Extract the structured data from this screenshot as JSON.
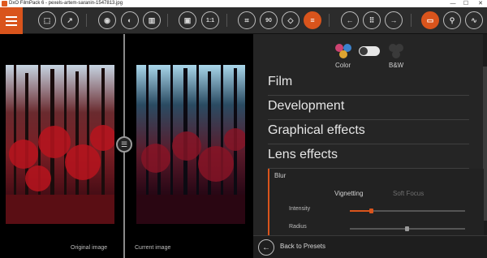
{
  "window": {
    "title": "DxO FilmPack 6 - pexels-artem-saranin-1547813.jpg",
    "minimize": "—",
    "maximize": "☐",
    "close": "✕"
  },
  "toolbar": {
    "hamburger_icon": "menu-icon",
    "buttons": [
      {
        "name": "import-photo-button",
        "glyph": "⬚"
      },
      {
        "name": "export-photo-button",
        "glyph": "↗"
      },
      {
        "name": "preview-eye-button",
        "glyph": "◉"
      },
      {
        "name": "compare-presets-button",
        "glyph": "◐"
      },
      {
        "name": "split-view-button",
        "glyph": "▥"
      },
      {
        "name": "fit-to-screen-button",
        "glyph": "▣"
      },
      {
        "name": "zoom-100-button",
        "glyph": "1:1"
      },
      {
        "name": "crop-button",
        "glyph": "⌗"
      },
      {
        "name": "rotate-90-button",
        "glyph": "90"
      },
      {
        "name": "straighten-button",
        "glyph": "◇"
      },
      {
        "name": "adjustments-button",
        "glyph": "≡"
      },
      {
        "name": "previous-image-button",
        "glyph": "←"
      },
      {
        "name": "grid-view-button",
        "glyph": "⠿"
      },
      {
        "name": "next-image-button",
        "glyph": "→"
      },
      {
        "name": "monitor-view-button",
        "glyph": "▭"
      },
      {
        "name": "loupe-button",
        "glyph": "⚲"
      },
      {
        "name": "histogram-button",
        "glyph": "∿"
      }
    ]
  },
  "viewer": {
    "original_label": "Original image",
    "current_label": "Current image",
    "split_handle_glyph": "☰"
  },
  "panel": {
    "color_label": "Color",
    "bw_label": "B&W",
    "sections": [
      "Film",
      "Development",
      "Graphical effects",
      "Lens effects"
    ],
    "lens_effects": {
      "subsection": "Blur",
      "tabs": [
        "Vignetting",
        "Soft Focus"
      ],
      "rows": [
        {
          "label": "Intensity",
          "value": 0.18
        },
        {
          "label": "Radius",
          "value": 0.5
        }
      ]
    },
    "back_label": "Back to Presets",
    "back_glyph": "←"
  },
  "colors": {
    "accent": "#d9541c"
  }
}
